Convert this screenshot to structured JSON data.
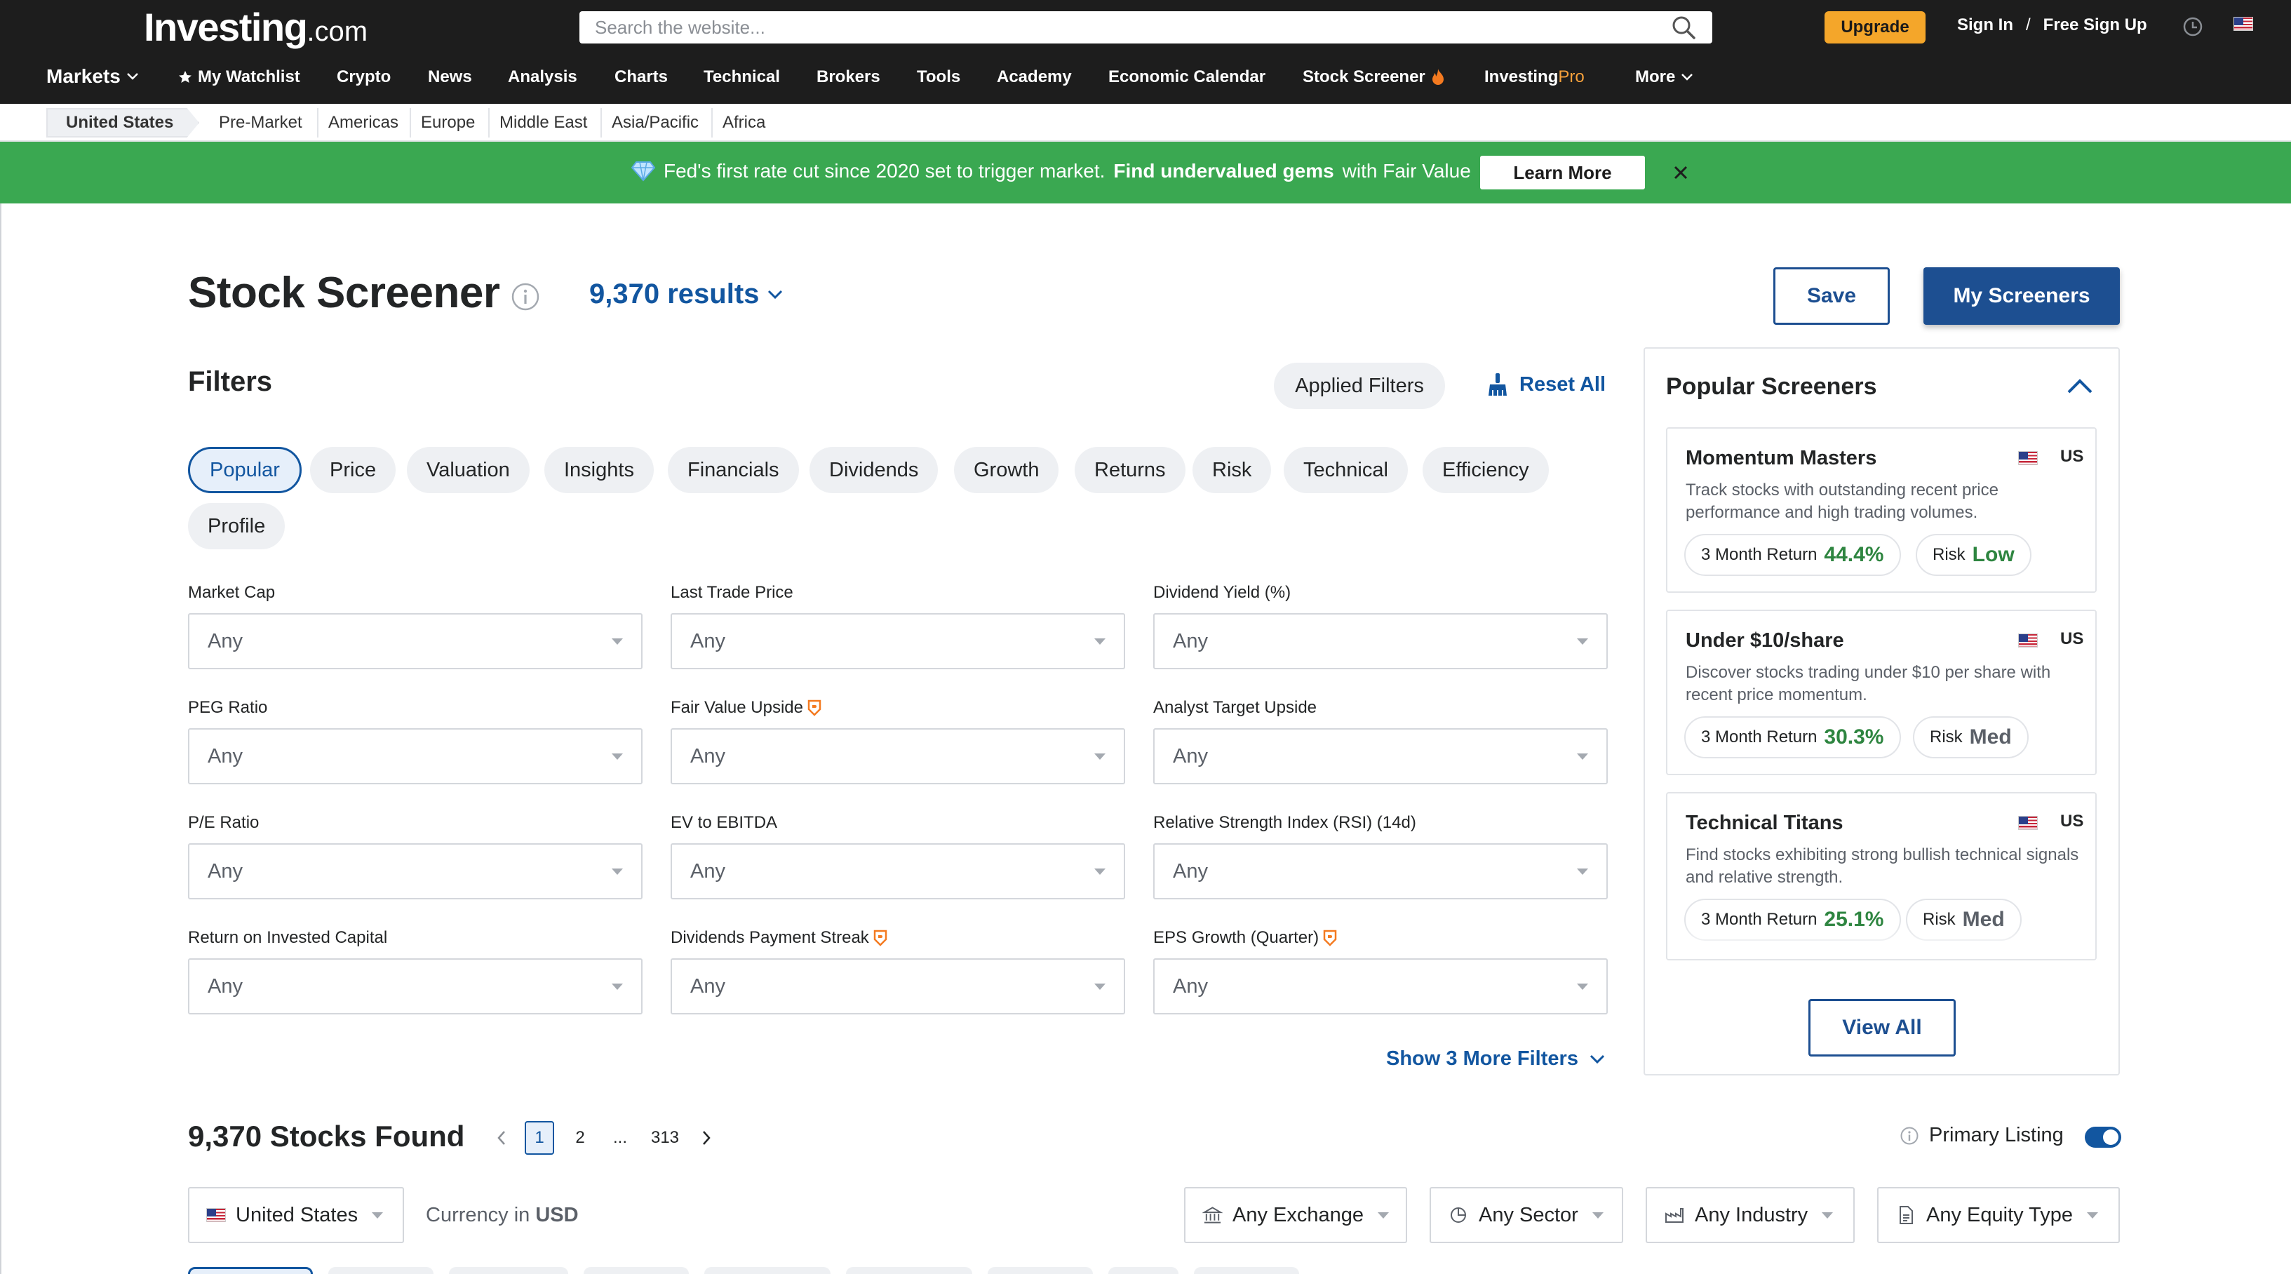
{
  "header": {
    "logo_brand": "Investing",
    "logo_suffix": ".com",
    "search_placeholder": "Search the website...",
    "upgrade_label": "Upgrade",
    "sign_in": "Sign In",
    "separator": "/",
    "free_sign_up": "Free Sign Up"
  },
  "nav": {
    "markets": "Markets",
    "watchlist": "My Watchlist",
    "crypto": "Crypto",
    "news": "News",
    "analysis": "Analysis",
    "charts": "Charts",
    "technical": "Technical",
    "brokers": "Brokers",
    "tools": "Tools",
    "academy": "Academy",
    "economic_calendar": "Economic Calendar",
    "stock_screener": "Stock Screener",
    "investing_pro_a": "Investing",
    "investing_pro_b": "Pro",
    "more": "More"
  },
  "subnav": {
    "current": "United States",
    "items": [
      "Pre-Market",
      "Americas",
      "Europe",
      "Middle East",
      "Asia/Pacific",
      "Africa"
    ]
  },
  "banner": {
    "text_a": "Fed's first rate cut since 2020 set to trigger market.",
    "text_b": "Find undervalued gems",
    "text_c": "with Fair Value",
    "learn_more": "Learn More"
  },
  "page": {
    "title": "Stock Screener",
    "results": "9,370 results",
    "save": "Save",
    "my_screeners": "My Screeners"
  },
  "filters": {
    "heading": "Filters",
    "applied": "Applied Filters",
    "reset_all": "Reset All",
    "tabs": [
      "Popular",
      "Price",
      "Valuation",
      "Insights",
      "Financials",
      "Dividends",
      "Growth",
      "Returns",
      "Risk",
      "Technical",
      "Efficiency",
      "Profile"
    ],
    "active_tab": "Popular",
    "fields": [
      {
        "label": "Market Cap",
        "value": "Any",
        "pro": false
      },
      {
        "label": "Last Trade Price",
        "value": "Any",
        "pro": false
      },
      {
        "label": "Dividend Yield (%)",
        "value": "Any",
        "pro": false
      },
      {
        "label": "PEG Ratio",
        "value": "Any",
        "pro": false
      },
      {
        "label": "Fair Value Upside",
        "value": "Any",
        "pro": true
      },
      {
        "label": "Analyst Target Upside",
        "value": "Any",
        "pro": false
      },
      {
        "label": "P/E Ratio",
        "value": "Any",
        "pro": false
      },
      {
        "label": "EV to EBITDA",
        "value": "Any",
        "pro": false
      },
      {
        "label": "Relative Strength Index (RSI) (14d)",
        "value": "Any",
        "pro": false
      },
      {
        "label": "Return on Invested Capital",
        "value": "Any",
        "pro": false
      },
      {
        "label": "Dividends Payment Streak",
        "value": "Any",
        "pro": true
      },
      {
        "label": "EPS Growth (Quarter)",
        "value": "Any",
        "pro": true
      }
    ],
    "show_more": "Show 3 More Filters"
  },
  "popular": {
    "heading": "Popular Screeners",
    "cards": [
      {
        "title": "Momentum Masters",
        "country": "US",
        "desc": "Track stocks with outstanding recent price performance and high trading volumes.",
        "return_label": "3 Month Return",
        "return_value": "44.4%",
        "risk_label": "Risk",
        "risk_value": "Low"
      },
      {
        "title": "Under $10/share",
        "country": "US",
        "desc": "Discover stocks trading under $10 per share with recent price momentum.",
        "return_label": "3 Month Return",
        "return_value": "30.3%",
        "risk_label": "Risk",
        "risk_value": "Med"
      },
      {
        "title": "Technical Titans",
        "country": "US",
        "desc": "Find stocks exhibiting strong bullish technical signals and relative strength.",
        "return_label": "3 Month Return",
        "return_value": "25.1%",
        "risk_label": "Risk",
        "risk_value": "Med"
      }
    ],
    "view_all": "View All"
  },
  "results_bar": {
    "found": "9,370 Stocks Found",
    "pages": [
      "1",
      "2",
      "...",
      "313"
    ],
    "current_page": "1",
    "primary_listing": "Primary Listing",
    "primary_listing_on": true,
    "country": "United States",
    "currency_label": "Currency in",
    "currency": "USD",
    "exchange": "Any Exchange",
    "sector": "Any Sector",
    "industry": "Any Industry",
    "equity_type": "Any Equity Type"
  },
  "colors": {
    "accent": "#1256a0",
    "brand_dark": "#1d1d1d",
    "banner_green": "#3aa851",
    "upgrade_orange": "#f4a62a",
    "positive": "#2e8540"
  }
}
